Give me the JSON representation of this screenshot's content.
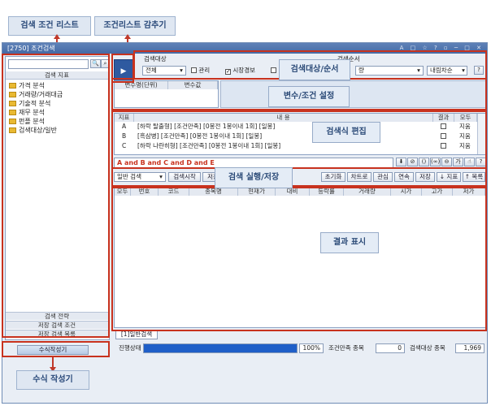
{
  "callouts": {
    "search_list": "검색 조건 리스트",
    "hide_list": "조건리스트 감추기",
    "target_order": "검색대상/순서",
    "var_setting": "변수/조건 설정",
    "formula_edit": "검색식 편집",
    "run_save": "검색 실행/저장",
    "result_view": "결과 표시",
    "formula_builder": "수식 작성기"
  },
  "window": {
    "title": "[2750] 조건검색",
    "title_icons": "A □ ☆ ? ▫ ─ □ ✕"
  },
  "sidebar": {
    "search_placeholder": "",
    "tab_label": "검색 지표",
    "items": [
      {
        "label": "가격 분석"
      },
      {
        "label": "거래량/거래대금"
      },
      {
        "label": "기술적 분석"
      },
      {
        "label": "재무 분석"
      },
      {
        "label": "펀플 분석"
      },
      {
        "label": "검색대상/일반"
      }
    ],
    "bottom_tabs": [
      "검색 전략",
      "저장 검색 조건",
      "저장 검색 목록"
    ],
    "builder_button": "수식작성기"
  },
  "target": {
    "label": "검색대상",
    "select_value": "전체",
    "checks": [
      {
        "label": "관리",
        "checked": false
      },
      {
        "label": "시장경보",
        "checked": true
      },
      {
        "label": "",
        "checked": false
      }
    ],
    "order_label": "검색순서",
    "order_value": "량",
    "order_dir": "내림차순"
  },
  "var_table": {
    "headers": [
      "변수명(단위)",
      "변수값"
    ]
  },
  "formula_table": {
    "headers": [
      "지표",
      "내 용",
      "결과",
      "모두"
    ],
    "rows": [
      {
        "id": "A",
        "content": "[하락 탈출형] [조건만족] [0봉전 1봉이내 1회] [일봉]",
        "result": false,
        "action": "지움"
      },
      {
        "id": "B",
        "content": "[흑삼병] [조건만족] [0봉전 1봉이내 1회] [일봉]",
        "result": false,
        "action": "지움"
      },
      {
        "id": "C",
        "content": "[하락 나란히형] [조건만족] [0봉전 1봉이내 1회] [일봉]",
        "result": false,
        "action": "지움"
      }
    ],
    "expression": "A and B and C and D and E"
  },
  "run_bar": {
    "mode": "일반 검색",
    "buttons": [
      "검색시작",
      "저장",
      "초기화",
      "차트로",
      "관심",
      "연속",
      "저장",
      "↓ 지표",
      "↑ 목록"
    ]
  },
  "result_table": {
    "headers": [
      "모두",
      "번호",
      "코드",
      "종목명",
      "현재가",
      "대비",
      "등락률",
      "거래량",
      "시가",
      "고가",
      "저가"
    ]
  },
  "bottom_tab": "[1]일반검색",
  "status": {
    "label": "진행상태",
    "progress": 100,
    "progress_text": "100%",
    "match_label": "조건만족 종목",
    "match_value": "0",
    "target_label": "검색대상 종목",
    "target_value": "1,969"
  },
  "colors": {
    "accent_red": "#c8321e",
    "progress_blue": "#1f5fc8",
    "callout_bg": "#dfe7f2"
  }
}
